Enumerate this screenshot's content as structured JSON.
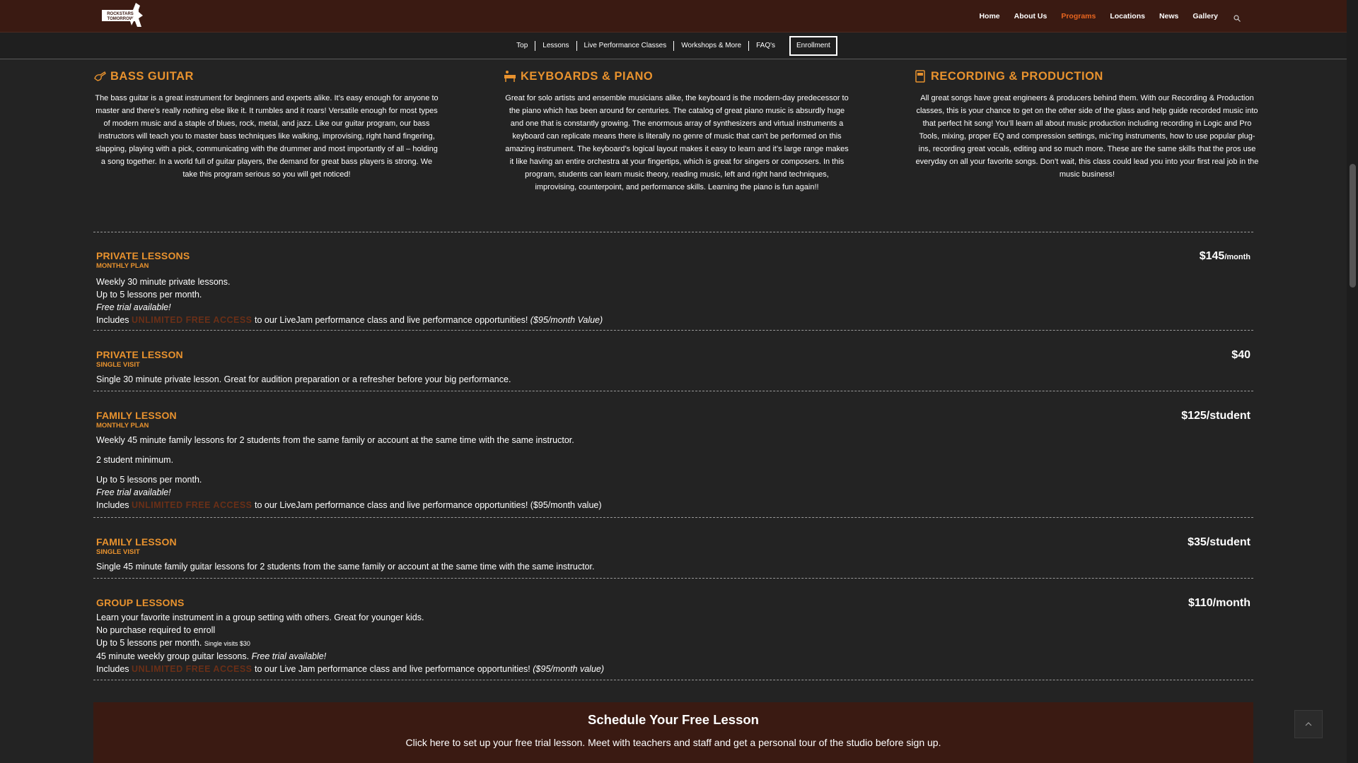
{
  "header": {
    "logo_alt": "ROCKSTARS OF TOMORROW",
    "nav": [
      "Home",
      "About Us",
      "Programs",
      "Locations",
      "News",
      "Gallery"
    ],
    "active_nav": "Programs",
    "search_icon": "search-icon"
  },
  "subnav": {
    "items": [
      "Top",
      "Lessons",
      "Live Performance Classes",
      "Workshops & More",
      "FAQ's"
    ],
    "enroll": "Enrollment"
  },
  "sections": {
    "bass": {
      "title": "BASS GUITAR",
      "icon": "bass-guitar-icon",
      "body": "The bass guitar is a great instrument for beginners and experts alike. It’s easy enough for anyone to master and there’s really nothing else like it. It rumbles and it roars! Versatile enough for most types of modern music and a staple of blues, rock, metal, and jazz. Like our guitar program, our bass instructors will teach you to master bass techniques like walking, improvising, right hand fingering, slapping, playing with a pick, communicating with the drummer and most importantly of all – holding a song together.  In a world full of guitar players, the demand for great bass players is strong. We take this program serious so you will get noticed!"
    },
    "keys": {
      "title": "KEYBOARDS & PIANO",
      "icon": "piano-icon",
      "body": "Great for solo artists and ensemble musicians alike, the keyboard is the modern-day predecessor to the piano which has been around for centuries. The catalog of great piano music is absurdly huge and one that is constantly growing. The enormous array of synthesizers and virtual instruments a keyboard can replicate means there is literally no genre of music that can’t be performed on this amazing instrument. The keyboard’s logical layout makes it easy to learn and it’s large range makes it like having an entire orchestra at your fingertips, which is great for singers or composers. In this program, students can learn music theory, reading music, left and right hand techniques, improvising, counterpoint, and performance skills. Learning the piano is fun again!!"
    },
    "recording": {
      "title": "RECORDING & PRODUCTION",
      "icon": "recorder-icon",
      "body": "All great songs have great engineers & producers behind them. With our Recording & Production classes, this is your chance to get on the other side of the glass and help guide recorded music into that perfect hit song!  You’ll learn all about music production including recording in Logic and Pro Tools, mixing, proper EQ and compression settings, mic’ing instruments, how to use popular plug-ins, recording great vocals, editing and so much more. These are the same skills that the pros use everyday on all your favorite songs. Don’t wait, this class could lead you into your first real job in the music business!"
    }
  },
  "plans": [
    {
      "title": "PRIVATE LESSONS",
      "sub": "MONTHLY PLAN",
      "price": "$145",
      "price_unit": "/month",
      "lines": [
        "Weekly 30 minute private lessons.",
        "Up to 5 lessons per month."
      ],
      "trial": "Free trial available!",
      "includes_pre": "Includes",
      "free_access": "UNLIMITED FREE ACCESS",
      "includes_post": "to our LiveJam performance class and live performance opportunities!",
      "value": "($95/month Value)"
    },
    {
      "title": "PRIVATE LESSON",
      "sub": "SINGLE VISIT",
      "price": "$40",
      "lines": [
        "Single 30 minute private lesson. Great for audition preparation or a refresher before your big performance."
      ]
    },
    {
      "title": "FAMILY LESSON",
      "sub": "MONTHLY PLAN",
      "price": "$125/student",
      "lines": [
        "Weekly 45 minute family lessons for 2 students from the same family or account at the same time with the same instructor.",
        "2 student minimum.",
        "Up to 5 lessons per month."
      ],
      "trial": "Free trial available!",
      "includes_pre": "Includes",
      "free_access": "UNLIMITED FREE ACCESS",
      "includes_post": "to our LiveJam performance class and live performance opportunities! ($95/month value)"
    },
    {
      "title": "FAMILY LESSON",
      "sub": "SINGLE VISIT",
      "price": "$35/student",
      "lines": [
        "Single 45 minute family guitar lessons for 2 students from the same family or account at the same time with the same instructor."
      ]
    },
    {
      "title": "GROUP LESSONS",
      "price": "$110/month",
      "lines": [
        "Learn your favorite instrument in a group setting with others. Great for younger kids.",
        "No purchase required to enroll",
        "Up to 5 lessons per month."
      ],
      "single_visits": "Single visits $30",
      "weekly_line": "45 minute weekly group guitar lessons.",
      "trial": "Free trial available!",
      "includes_pre": "Includes",
      "free_access": "UNLIMITED FREE ACCESS",
      "includes_post": "to our Live Jam performance class and live performance opportunities!",
      "value": "($95/month value)"
    }
  ],
  "cta": {
    "title": "Schedule Your Free Lesson",
    "text": "Click here to set up your free trial lesson. Meet with teachers and staff and get a personal tour of the studio before sign up."
  },
  "to_top_icon": "chevron-up-icon",
  "colors": {
    "accent": "#e8922e",
    "nav_active": "#e8651f",
    "header_bg": "#3a1a12",
    "page_bg": "#232323"
  }
}
